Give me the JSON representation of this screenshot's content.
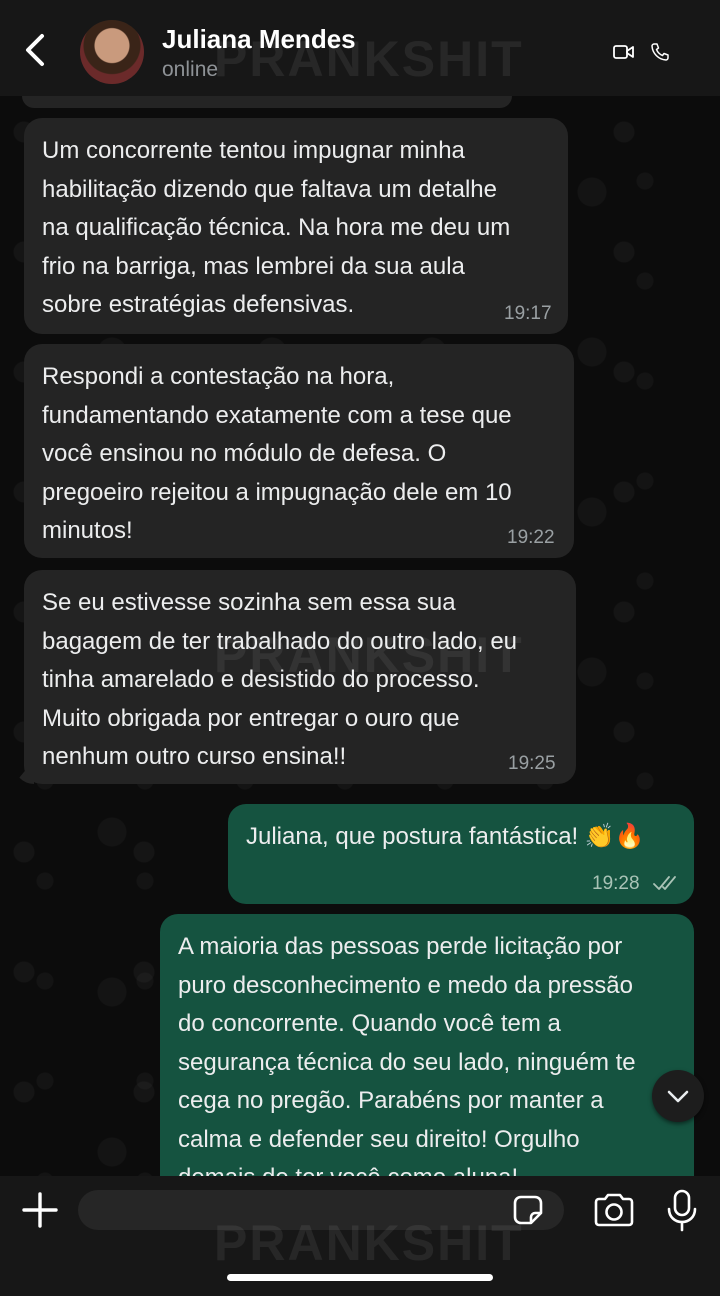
{
  "header": {
    "contact_name": "Juliana Mendes",
    "status": "online",
    "watermark": "PRANKSHIT"
  },
  "messages": [
    {
      "direction": "incoming",
      "lines": [
        "Um concorrente tentou impugnar minha",
        "habilitação dizendo que faltava um detalhe",
        "na qualificação técnica. Na hora me deu um",
        "frio na barriga, mas lembrei da sua aula",
        "sobre estratégias defensivas."
      ],
      "time": "19:17"
    },
    {
      "direction": "incoming",
      "lines": [
        "Respondi a contestação na hora,",
        "fundamentando exatamente com a tese que",
        "você ensinou no módulo de defesa. O",
        "pregoeiro rejeitou a impugnação dele em 10",
        "minutos!"
      ],
      "time": "19:22"
    },
    {
      "direction": "incoming",
      "lines": [
        "Se eu estivesse sozinha sem essa sua",
        "bagagem de ter trabalhado do outro lado, eu",
        "tinha amarelado e desistido do processo.",
        "Muito obrigada por entregar o ouro que",
        "nenhum outro curso ensina!!"
      ],
      "time": "19:25"
    },
    {
      "direction": "outgoing",
      "lines": [
        "Juliana, que postura fantástica! 👏🔥"
      ],
      "time": "19:28",
      "status": "read"
    },
    {
      "direction": "outgoing",
      "lines": [
        "A maioria das pessoas perde licitação por",
        "puro desconhecimento e medo da pressão",
        "do concorrente. Quando você tem a",
        "segurança técnica do seu lado, ninguém te",
        "cega no pregão. Parabéns por manter a",
        "calma e defender seu direito! Orgulho",
        "demais de ter você como aluna!"
      ],
      "time": ""
    }
  ],
  "composer": {
    "placeholder": ""
  },
  "icons": {
    "back": "chevron-left-icon",
    "video": "video-camera-icon",
    "call": "phone-icon",
    "plus": "plus-icon",
    "sticker": "sticker-icon",
    "camera": "camera-icon",
    "mic": "microphone-icon",
    "scroll": "chevron-down-icon",
    "read": "double-check-icon"
  },
  "colors": {
    "incoming_bubble": "#242424",
    "outgoing_bubble": "#155340",
    "header": "#171717"
  }
}
